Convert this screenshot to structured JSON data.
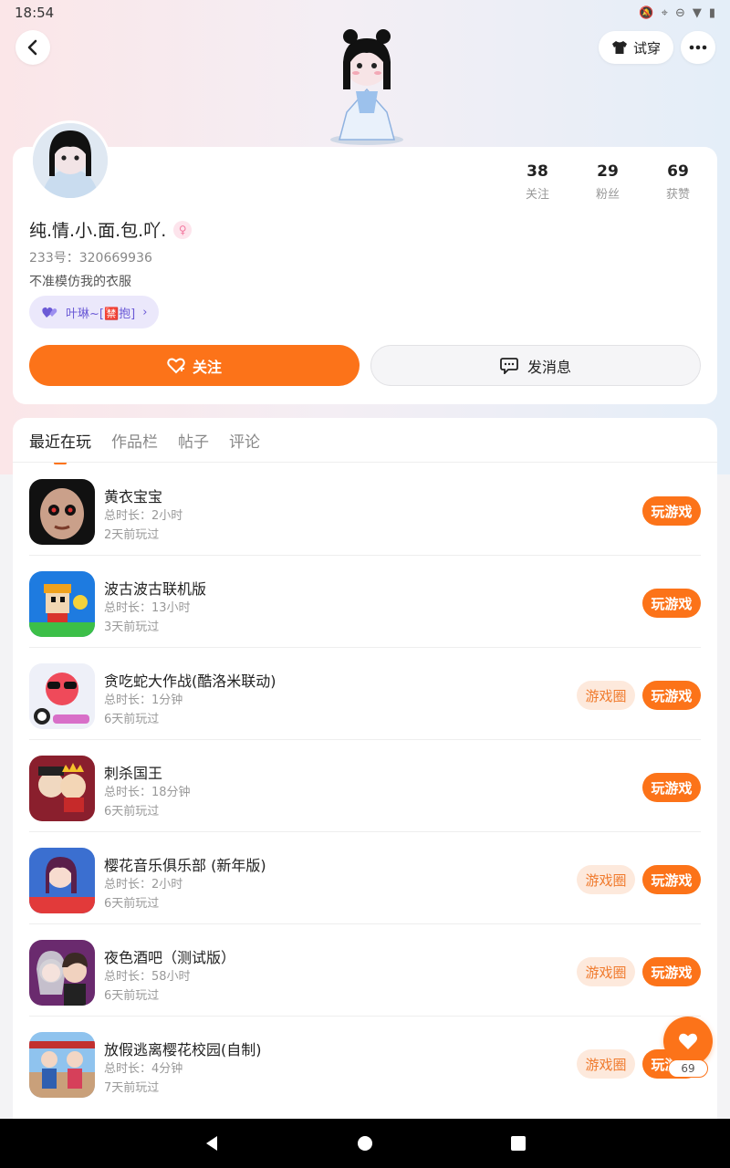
{
  "status_bar": {
    "time": "18:54"
  },
  "header": {
    "tryon_label": "试穿"
  },
  "profile": {
    "nickname": "纯.情.小.面.包.吖.",
    "uid": "233号：320669936",
    "bio": "不准模仿我的衣服",
    "relation_chip": "叶琳~[🈲抱]",
    "stats": [
      {
        "value": "38",
        "label": "关注"
      },
      {
        "value": "29",
        "label": "粉丝"
      },
      {
        "value": "69",
        "label": "获赞"
      }
    ],
    "follow_label": "关注",
    "message_label": "发消息"
  },
  "tabs": [
    "最近在玩",
    "作品栏",
    "帖子",
    "评论"
  ],
  "games": [
    {
      "name": "黄衣宝宝",
      "duration": "总时长：2小时",
      "last_played": "2天前玩过",
      "has_circle": false
    },
    {
      "name": "波古波古联机版",
      "duration": "总时长：13小时",
      "last_played": "3天前玩过",
      "has_circle": false
    },
    {
      "name": "贪吃蛇大作战(酷洛米联动)",
      "duration": "总时长：1分钟",
      "last_played": "6天前玩过",
      "has_circle": true
    },
    {
      "name": "刺杀国王",
      "duration": "总时长：18分钟",
      "last_played": "6天前玩过",
      "has_circle": false
    },
    {
      "name": "樱花音乐俱乐部 (新年版)",
      "duration": "总时长：2小时",
      "last_played": "6天前玩过",
      "has_circle": true
    },
    {
      "name": "夜色酒吧（测试版）",
      "duration": "总时长：58小时",
      "last_played": "6天前玩过",
      "has_circle": true
    },
    {
      "name": "放假逃离樱花校园(自制)",
      "duration": "总时长：4分钟",
      "last_played": "7天前玩过",
      "has_circle": true
    }
  ],
  "game_buttons": {
    "play_label": "玩游戏",
    "circle_label": "游戏圈"
  },
  "like_fab": {
    "count": "69"
  },
  "colors": {
    "accent": "#fc7319",
    "circle_bg": "#fde9dc",
    "chip_bg": "#ebe8fb"
  }
}
